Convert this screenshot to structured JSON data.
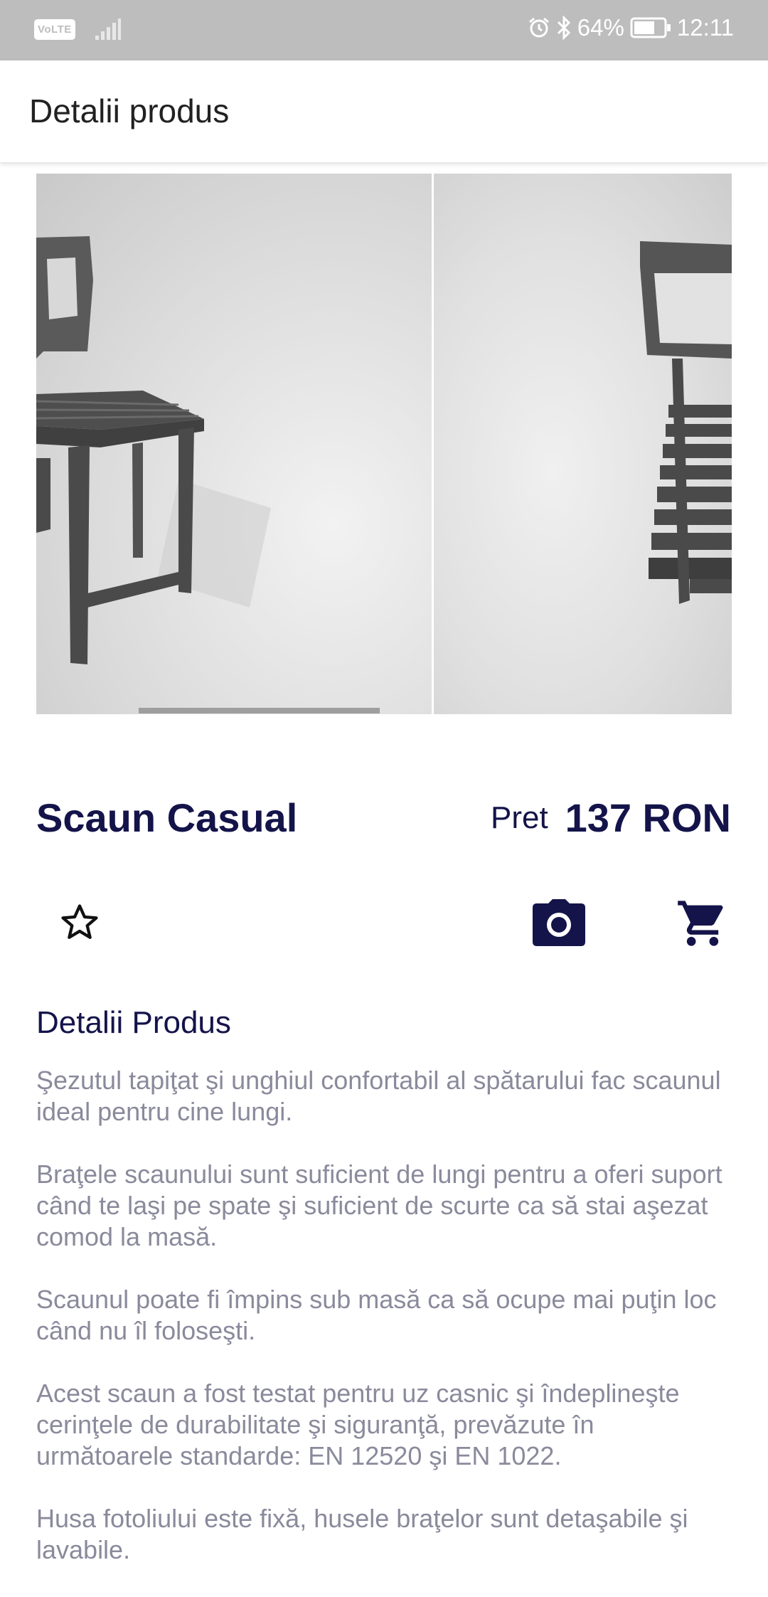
{
  "status_bar": {
    "network_label": "VoLTE",
    "battery": "64%",
    "time": "12:11",
    "icons": [
      "signal-icon",
      "alarm-icon",
      "bluetooth-icon",
      "battery-icon"
    ]
  },
  "app_bar": {
    "title": "Detalii produs"
  },
  "gallery": {
    "images": [
      "chair-front-view",
      "chair-side-view"
    ]
  },
  "product": {
    "name": "Scaun Casual",
    "price_label": "Pret",
    "price_value": "137 RON"
  },
  "actions": {
    "favorite_icon": "star-outline-icon",
    "camera_icon": "camera-icon",
    "cart_icon": "cart-icon"
  },
  "details": {
    "title": "Detalii Produs",
    "paragraphs": [
      "Şezutul tapiţat şi unghiul confortabil al spătarului fac scaunul ideal pentru cine lungi.",
      "Braţele scaunului sunt suficient de lungi pentru a oferi suport când te laşi pe spate şi suficient de scurte ca să stai aşezat comod la masă.",
      "Scaunul poate fi împins sub masă ca să ocupe mai puţin loc când nu îl foloseşti.",
      "Acest scaun a fost testat pentru uz casnic şi îndeplineşte cerinţele de durabilitate şi siguranţă, prevăzute în următoarele standarde: EN 12520 şi EN 1022.",
      "Husa fotoliului este fixă, husele braţelor sunt detaşabile şi lavabile."
    ]
  },
  "colors": {
    "status_bar": "#bdbdbd",
    "primary_text": "#14144a",
    "description_text": "#8a8a9c"
  }
}
